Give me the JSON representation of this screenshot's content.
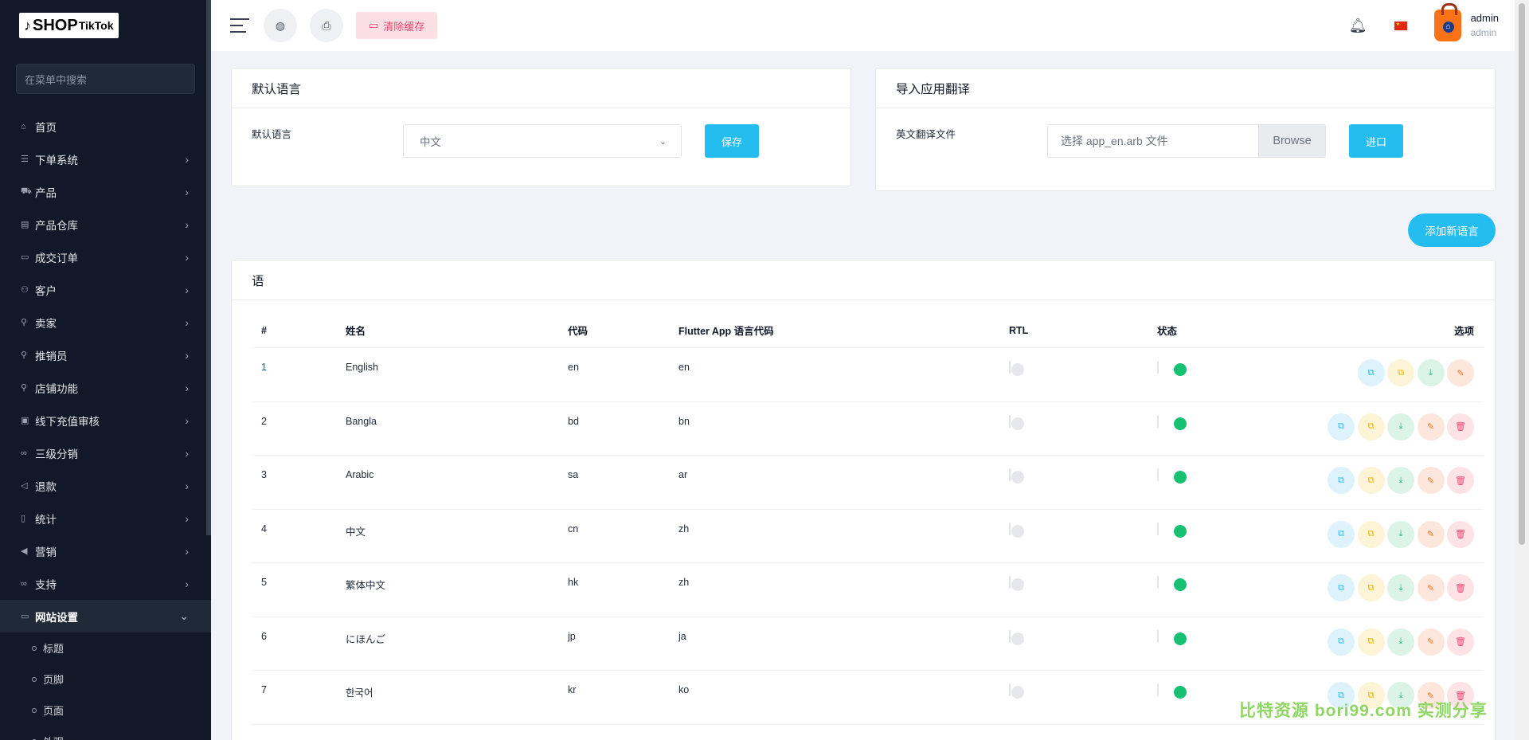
{
  "brand": {
    "logo_text": "SHOP",
    "logo_sub": "TikTok"
  },
  "sidebar": {
    "search_placeholder": "在菜单中搜索",
    "items": [
      {
        "label": "首页",
        "icon": "home-icon"
      },
      {
        "label": "下单系统",
        "icon": "list-icon"
      },
      {
        "label": "产品",
        "icon": "cart-icon"
      },
      {
        "label": "产品仓库",
        "icon": "warehouse-icon"
      },
      {
        "label": "成交订单",
        "icon": "order-icon"
      },
      {
        "label": "客户",
        "icon": "users-icon"
      },
      {
        "label": "卖家",
        "icon": "user-icon"
      },
      {
        "label": "推销员",
        "icon": "user-icon"
      },
      {
        "label": "店铺功能",
        "icon": "user-icon"
      },
      {
        "label": "线下充值审核",
        "icon": "money-icon"
      },
      {
        "label": "三级分销",
        "icon": "link-icon"
      },
      {
        "label": "退款",
        "icon": "back-icon"
      },
      {
        "label": "统计",
        "icon": "file-icon"
      },
      {
        "label": "营销",
        "icon": "megaphone-icon"
      },
      {
        "label": "支持",
        "icon": "link-icon"
      },
      {
        "label": "网站设置",
        "icon": "monitor-icon"
      }
    ],
    "sub_items": [
      "标题",
      "页脚",
      "页面",
      "外观"
    ]
  },
  "topbar": {
    "clear_cache": "清除缓存",
    "user_name": "admin",
    "user_role": "admin"
  },
  "default_lang_card": {
    "title": "默认语言",
    "label": "默认语言",
    "selected": "中文",
    "save": "保存"
  },
  "import_card": {
    "title": "导入应用翻译",
    "label": "英文翻译文件",
    "placeholder": "选择 app_en.arb 文件",
    "browse": "Browse",
    "import": "进口"
  },
  "add_language": "添加新语言",
  "lang_table": {
    "title": "语",
    "headers": [
      "#",
      "姓名",
      "代码",
      "Flutter App 语言代码",
      "RTL",
      "状态",
      "选项"
    ],
    "rows": [
      {
        "num": "1",
        "name": "English",
        "code": "en",
        "flutter": "en",
        "rtl": false,
        "status": true,
        "deletable": false
      },
      {
        "num": "2",
        "name": "Bangla",
        "code": "bd",
        "flutter": "bn",
        "rtl": false,
        "status": true,
        "deletable": true
      },
      {
        "num": "3",
        "name": "Arabic",
        "code": "sa",
        "flutter": "ar",
        "rtl": false,
        "status": true,
        "deletable": true
      },
      {
        "num": "4",
        "name": "中文",
        "code": "cn",
        "flutter": "zh",
        "rtl": false,
        "status": true,
        "deletable": true
      },
      {
        "num": "5",
        "name": "繁体中文",
        "code": "hk",
        "flutter": "zh",
        "rtl": false,
        "status": true,
        "deletable": true
      },
      {
        "num": "6",
        "name": "にほんご",
        "code": "jp",
        "flutter": "ja",
        "rtl": false,
        "status": true,
        "deletable": true
      },
      {
        "num": "7",
        "name": "한국어",
        "code": "kr",
        "flutter": "ko",
        "rtl": false,
        "status": true,
        "deletable": true
      }
    ]
  },
  "watermark": "比特资源 bori99.com 实测分享",
  "colors": {
    "sidebar_bg": "#111827",
    "accent": "#25bdf0",
    "toggle_on": "#16c172",
    "danger": "#ef476f"
  }
}
